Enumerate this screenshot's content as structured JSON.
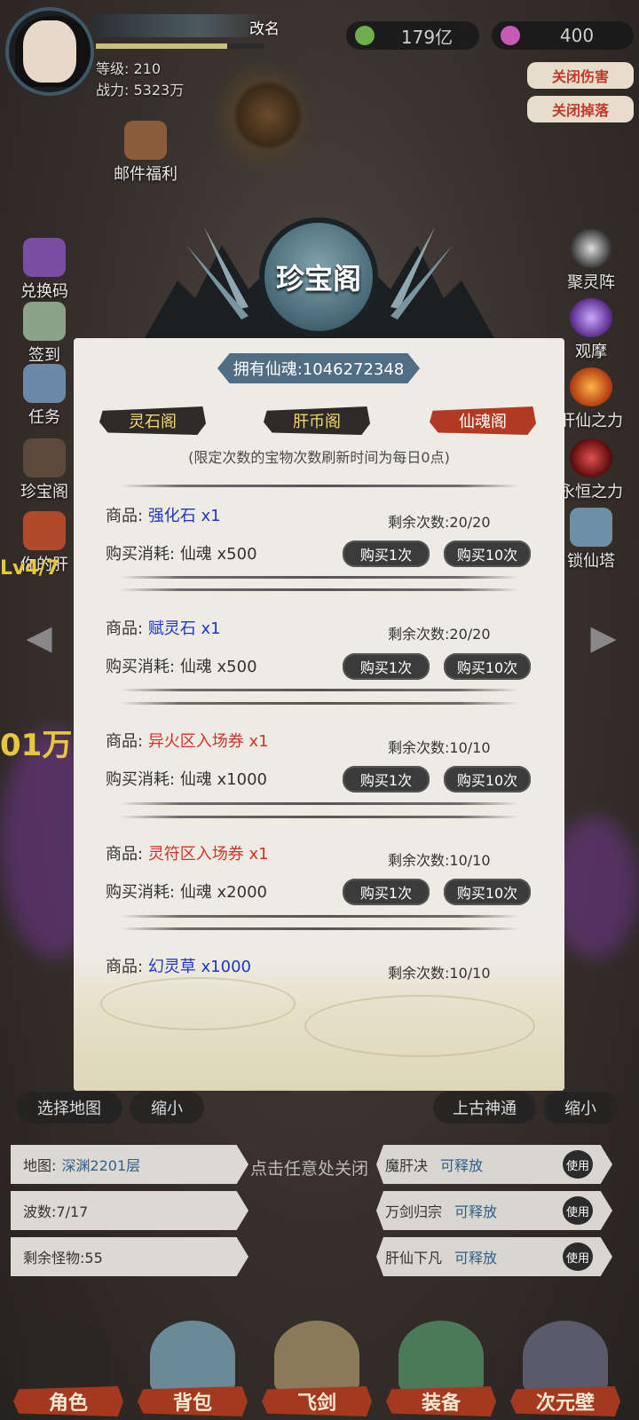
{
  "header": {
    "rename_label": "改名",
    "level_text": "等级: 210",
    "power_text": "战力: 5323万",
    "exp_fraction": 0.78,
    "currency1": "179亿",
    "currency2": "400",
    "close_damage": "关闭伤害",
    "close_drop": "关闭掉落",
    "mail_label": "邮件福利"
  },
  "left_menu": [
    "兑换码",
    "签到",
    "任务",
    "珍宝阁",
    "你的肝"
  ],
  "right_menu": [
    "聚灵阵",
    "观摩",
    "肝仙之力",
    "永恒之力",
    "锁仙塔"
  ],
  "modal": {
    "title": "珍宝阁",
    "soul_owned": "拥有仙魂:1046272348",
    "tabs": [
      {
        "label": "灵石阁",
        "active": false
      },
      {
        "label": "肝币阁",
        "active": false
      },
      {
        "label": "仙魂阁",
        "active": true
      }
    ],
    "note": "(限定次数的宝物次数刷新时间为每日0点)",
    "item_prefix": "商品:",
    "cost_prefix": "购买消耗:",
    "buy1": "购买1次",
    "buy10": "购买10次",
    "items": [
      {
        "name": "强化石 x1",
        "color": "#1f35c2",
        "remain": "剩余次数:20/20",
        "cost": "仙魂 x500"
      },
      {
        "name": "赋灵石 x1",
        "color": "#1f35c2",
        "remain": "剩余次数:20/20",
        "cost": "仙魂 x500"
      },
      {
        "name": "异火区入场券 x1",
        "color": "#d2322a",
        "remain": "剩余次数:10/10",
        "cost": "仙魂 x1000"
      },
      {
        "name": "灵符区入场券 x1",
        "color": "#d2322a",
        "remain": "剩余次数:10/10",
        "cost": "仙魂 x2000"
      },
      {
        "name": "幻灵草 x1000",
        "color": "#1f35c2",
        "remain": "剩余次数:10/10",
        "cost": ""
      }
    ]
  },
  "bottom": {
    "select_map": "选择地图",
    "shrink1": "缩小",
    "ancient_power": "上古神通",
    "shrink2": "缩小",
    "click_close": "点击任意处关闭",
    "map_label": "地图:",
    "map_value": "深渊2201层",
    "wave_label": "波数:7/17",
    "monsters_label": "剩余怪物:55",
    "skills": [
      {
        "name": "魔肝决",
        "status": "可释放",
        "use": "使用"
      },
      {
        "name": "万剑归宗",
        "status": "可释放",
        "use": "使用"
      },
      {
        "name": "肝仙下凡",
        "status": "可释放",
        "use": "使用"
      }
    ],
    "left_partial": "01万",
    "left_partial2": "Lv4/7"
  },
  "nav": [
    "角色",
    "背包",
    "飞剑",
    "装备",
    "次元壁"
  ],
  "colors": {
    "accent_red": "#b23a22",
    "soul_banner": "#4f6e83",
    "tab_gold": "#f2d872"
  }
}
